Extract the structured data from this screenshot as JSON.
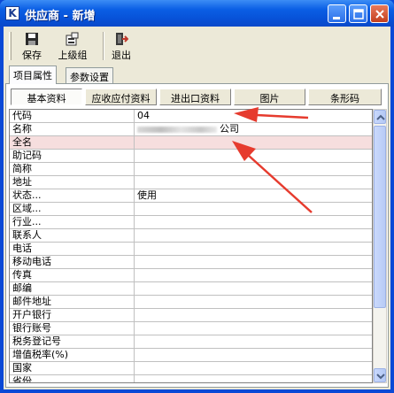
{
  "window": {
    "title": "供应商 - 新增",
    "app_icon_letter": "K",
    "controls": [
      "minimize-icon",
      "maximize-icon",
      "close-icon"
    ]
  },
  "toolbar": {
    "items": [
      {
        "label": "保存",
        "icon": "save-icon"
      },
      {
        "label": "上级组",
        "icon": "parent-group-icon"
      },
      {
        "label": "退出",
        "icon": "exit-icon"
      }
    ]
  },
  "tabs": {
    "primary": [
      {
        "label": "项目属性",
        "active": true
      },
      {
        "label": "参数设置",
        "active": false
      }
    ],
    "secondary": [
      {
        "label": "基本资料",
        "active": true
      },
      {
        "label": "应收应付资料",
        "active": false
      },
      {
        "label": "进出口资料",
        "active": false
      },
      {
        "label": "图片",
        "active": false
      },
      {
        "label": "条形码",
        "active": false
      }
    ]
  },
  "form": {
    "rows": [
      {
        "label": "代码",
        "value": "04"
      },
      {
        "label": "名称",
        "value": "公司",
        "redacted_prefix": true
      },
      {
        "label": "全名",
        "value": "",
        "highlighted": true
      },
      {
        "label": "助记码",
        "value": ""
      },
      {
        "label": "简称",
        "value": ""
      },
      {
        "label": "地址",
        "value": ""
      },
      {
        "label": "状态...",
        "value": "使用"
      },
      {
        "label": "区域...",
        "value": ""
      },
      {
        "label": "行业...",
        "value": ""
      },
      {
        "label": "联系人",
        "value": ""
      },
      {
        "label": "电话",
        "value": ""
      },
      {
        "label": "移动电话",
        "value": ""
      },
      {
        "label": "传真",
        "value": ""
      },
      {
        "label": "邮编",
        "value": ""
      },
      {
        "label": "邮件地址",
        "value": ""
      },
      {
        "label": "开户银行",
        "value": ""
      },
      {
        "label": "银行账号",
        "value": ""
      },
      {
        "label": "税务登记号",
        "value": ""
      },
      {
        "label": "增值税率(%)",
        "value": ""
      },
      {
        "label": "国家",
        "value": ""
      },
      {
        "label": "省份",
        "value": ""
      }
    ]
  },
  "colors": {
    "title_bar": "#0a5ce0",
    "frame": "#ece9d8",
    "highlight_row": "#f6dede",
    "annotation_arrow": "#e63b2e"
  }
}
